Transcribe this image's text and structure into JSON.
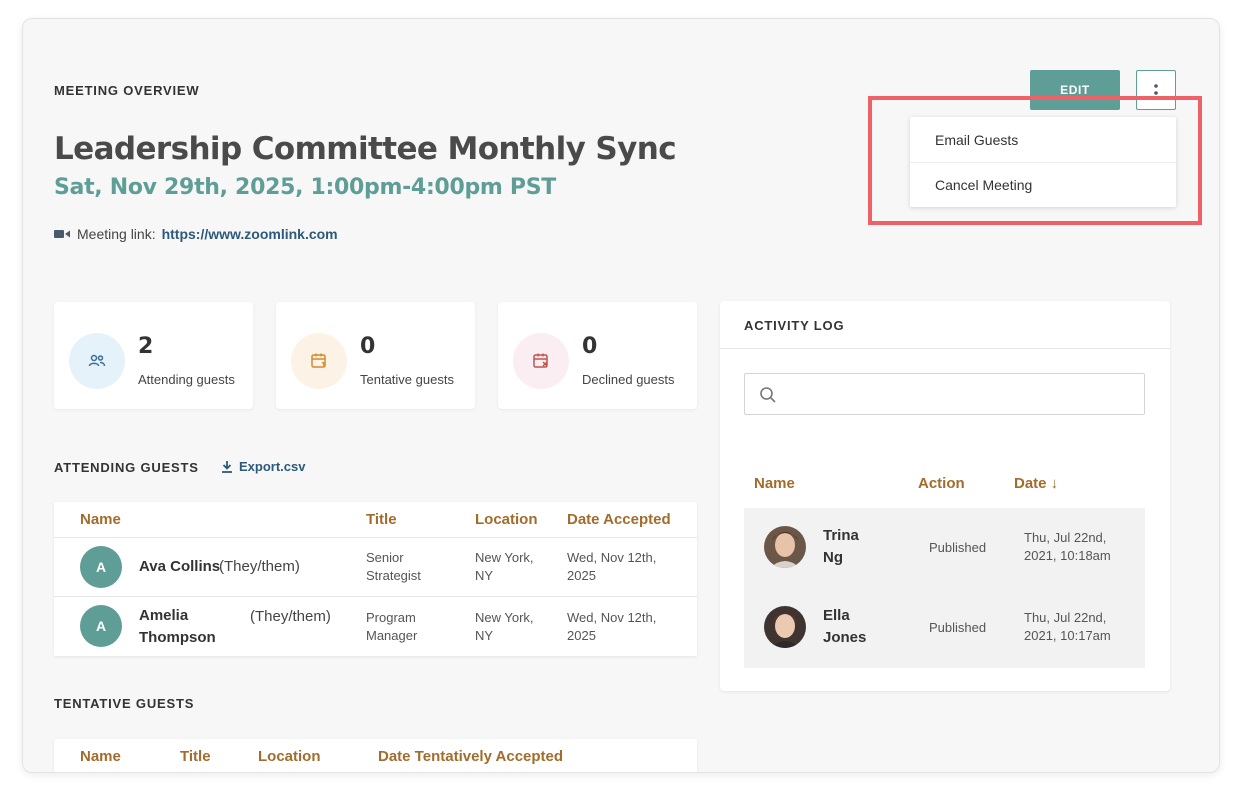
{
  "meeting": {
    "eyebrow": "MEETING OVERVIEW",
    "title": "Leadership Committee Monthly Sync",
    "datetime": "Sat, Nov 29th, 2025, 1:00pm-4:00pm PST",
    "link_label": "Meeting link:",
    "link_url": "https://www.zoomlink.com"
  },
  "actions": {
    "edit_label": "EDIT",
    "menu": [
      "Email Guests",
      "Cancel Meeting"
    ]
  },
  "stats": [
    {
      "value": "2",
      "label": "Attending guests",
      "icon": "people-icon",
      "color": "#e6f2fa"
    },
    {
      "value": "0",
      "label": "Tentative guests",
      "icon": "calendar-question-icon",
      "color": "#fdf2e6"
    },
    {
      "value": "0",
      "label": "Declined guests",
      "icon": "calendar-x-icon",
      "color": "#fbeef3"
    }
  ],
  "attending": {
    "heading": "ATTENDING GUESTS",
    "export_label": "Export.csv",
    "columns": [
      "Name",
      "Title",
      "Location",
      "Date Accepted"
    ],
    "rows": [
      {
        "initial": "A",
        "name_line1": "Ava Collins",
        "name_line2": "",
        "pronouns": "(They/them)",
        "title_line1": "Senior",
        "title_line2": "Strategist",
        "loc_line1": "New York,",
        "loc_line2": "NY",
        "date_line1": "Wed, Nov 12th,",
        "date_line2": "2025"
      },
      {
        "initial": "A",
        "name_line1": "Amelia",
        "name_line2": "Thompson",
        "pronouns": "(They/them)",
        "title_line1": "Program",
        "title_line2": "Manager",
        "loc_line1": "New York,",
        "loc_line2": "NY",
        "date_line1": "Wed, Nov 12th,",
        "date_line2": "2025"
      }
    ]
  },
  "tentative": {
    "heading": "TENTATIVE GUESTS",
    "columns": [
      "Name",
      "Title",
      "Location",
      "Date Tentatively Accepted"
    ]
  },
  "activity": {
    "heading": "ACTIVITY LOG",
    "search_placeholder": "",
    "columns": [
      "Name",
      "Action",
      "Date ↓"
    ],
    "rows": [
      {
        "name_line1": "Trina",
        "name_line2": "Ng",
        "action": "Published",
        "date_line1": "Thu, Jul 22nd,",
        "date_line2": "2021, 10:18am"
      },
      {
        "name_line1": "Ella",
        "name_line2": "Jones",
        "action": "Published",
        "date_line1": "Thu, Jul 22nd,",
        "date_line2": "2021, 10:17am"
      }
    ]
  },
  "colors": {
    "accent": "#5e9e96",
    "header_text": "#a26c2c",
    "link": "#2c5a7a",
    "highlight": "#ee6166"
  }
}
